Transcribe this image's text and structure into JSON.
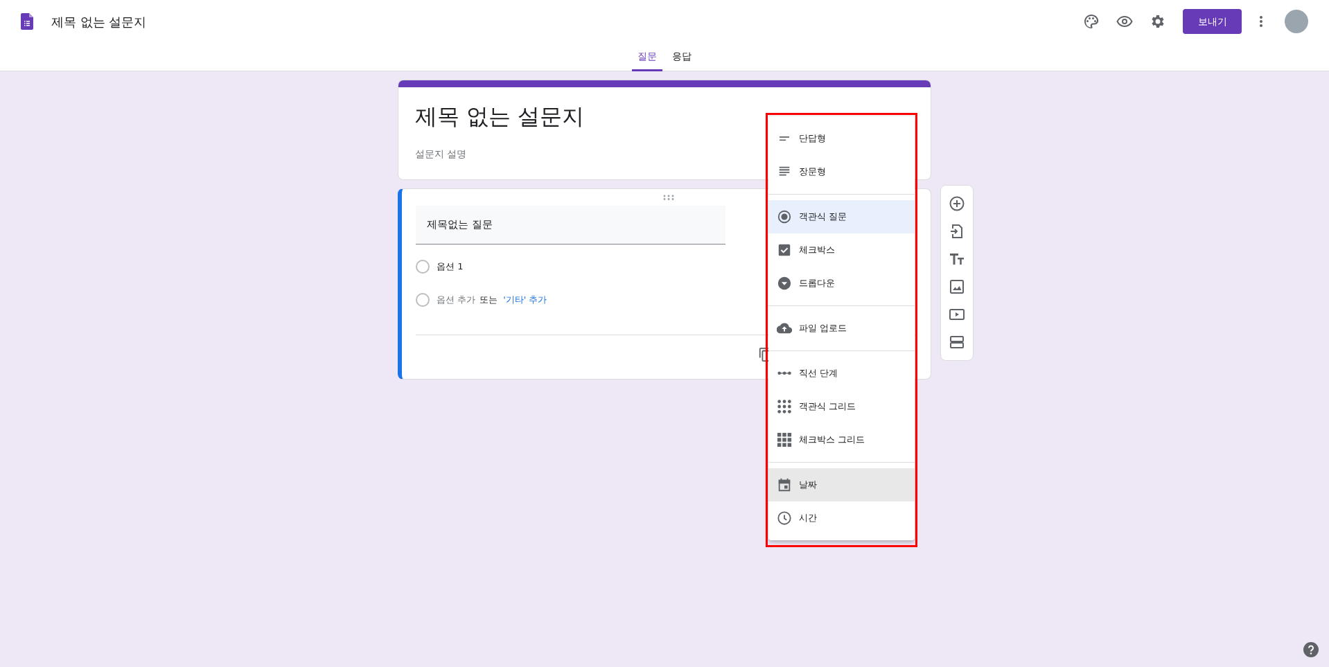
{
  "header": {
    "title": "제목 없는 설문지",
    "send_button": "보내기"
  },
  "tabs": [
    {
      "label": "질문",
      "selected": true
    },
    {
      "label": "응답",
      "selected": false
    }
  ],
  "form": {
    "title": "제목 없는 설문지",
    "description": "설문지 설명"
  },
  "question": {
    "title": "제목없는 질문",
    "options": [
      {
        "label": "옵션 1"
      }
    ],
    "add_option": "옵션 추가",
    "or_text": "또는",
    "add_other": "'기타' 추가"
  },
  "type_menu": {
    "groups": [
      [
        {
          "label": "단답형",
          "kind": "short",
          "selected": false,
          "hovered": false
        },
        {
          "label": "장문형",
          "kind": "paragraph",
          "selected": false,
          "hovered": false
        }
      ],
      [
        {
          "label": "객관식 질문",
          "kind": "radio",
          "selected": true,
          "hovered": false
        },
        {
          "label": "체크박스",
          "kind": "checkbox",
          "selected": false,
          "hovered": false
        },
        {
          "label": "드롭다운",
          "kind": "dropdown",
          "selected": false,
          "hovered": false
        }
      ],
      [
        {
          "label": "파일 업로드",
          "kind": "upload",
          "selected": false,
          "hovered": false
        }
      ],
      [
        {
          "label": "직선 단계",
          "kind": "scale",
          "selected": false,
          "hovered": false
        },
        {
          "label": "객관식 그리드",
          "kind": "radiogrid",
          "selected": false,
          "hovered": false
        },
        {
          "label": "체크박스 그리드",
          "kind": "checkgrid",
          "selected": false,
          "hovered": false
        }
      ],
      [
        {
          "label": "날짜",
          "kind": "date",
          "selected": false,
          "hovered": true
        },
        {
          "label": "시간",
          "kind": "time",
          "selected": false,
          "hovered": false
        }
      ]
    ]
  }
}
